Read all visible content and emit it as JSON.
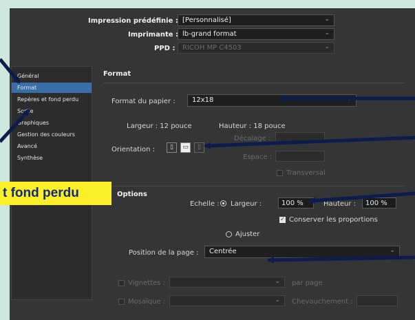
{
  "header": {
    "preset_label": "Impression prédéfinie :",
    "preset_value": "[Personnalisé]",
    "printer_label": "Imprimante :",
    "printer_value": "lb-grand format",
    "ppd_label": "PPD :",
    "ppd_value": "RICOH MP C4503"
  },
  "sidebar": {
    "items": [
      {
        "label": "Général"
      },
      {
        "label": "Format"
      },
      {
        "label": "Repères et fond perdu"
      },
      {
        "label": "Sortie"
      },
      {
        "label": "Graphiques"
      },
      {
        "label": "Gestion des couleurs"
      },
      {
        "label": "Avancé"
      },
      {
        "label": "Synthèse"
      }
    ],
    "active": "Format"
  },
  "format": {
    "section_title": "Format",
    "paper_label": "Format du papier :",
    "paper_value": "12x18",
    "width_text": "Largeur : 12 pouce",
    "height_text": "Hauteur : 18 pouce",
    "orientation_label": "Orientation :",
    "offset_label": "Décalage :",
    "spacing_label": "Espace :",
    "transverse_label": "Transversal"
  },
  "options": {
    "section_title": "Options",
    "scale_label": "Echelle :",
    "width_label": "Largeur :",
    "width_value": "100 %",
    "height_label": "Hauteur :",
    "height_value": "100 %",
    "keep_proportions_label": "Conserver les proportions",
    "fit_label": "Ajuster",
    "page_position_label": "Position de la page :",
    "page_position_value": "Centrée",
    "thumbnails_label": "Vignettes :",
    "per_page_label": "par page",
    "mosaic_label": "Mosaïque :",
    "overlap_label": "Chevauchement :"
  },
  "callout": {
    "text": "t fond perdu"
  },
  "colors": {
    "dialog_bg": "#353535",
    "highlight": "#3a6ea8",
    "callout_bg": "#fbef2a",
    "callout_text": "#122a7a",
    "arrow": "#0d1b4d"
  }
}
